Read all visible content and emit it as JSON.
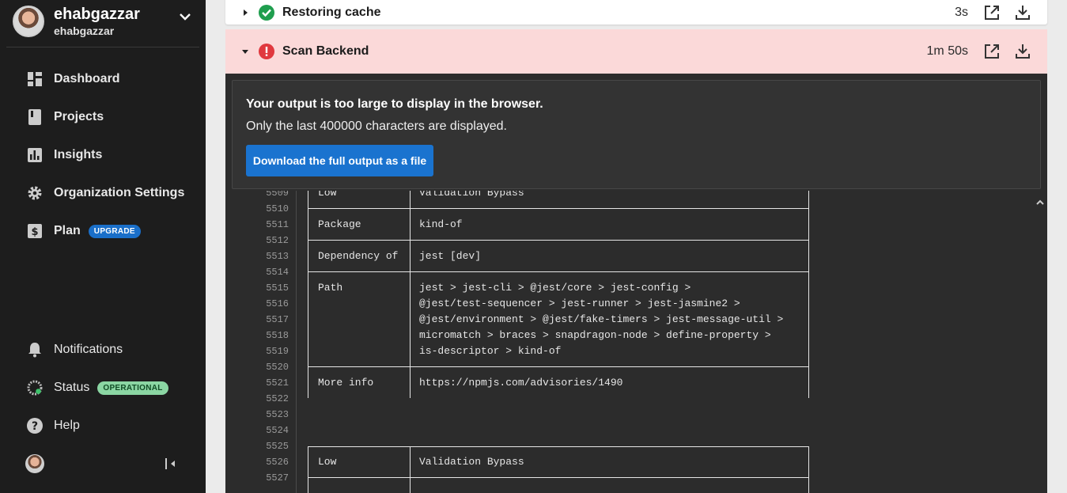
{
  "account": {
    "name": "ehabgazzar",
    "org": "ehabgazzar"
  },
  "nav": [
    {
      "label": "Dashboard",
      "icon": "dashboard-icon"
    },
    {
      "label": "Projects",
      "icon": "projects-icon"
    },
    {
      "label": "Insights",
      "icon": "insights-icon"
    },
    {
      "label": "Organization Settings",
      "icon": "gear-icon"
    },
    {
      "label": "Plan",
      "icon": "dollar-icon",
      "badge": "UPGRADE"
    }
  ],
  "nav_bottom": [
    {
      "label": "Notifications",
      "icon": "bell-icon"
    },
    {
      "label": "Status",
      "icon": "status-icon",
      "badge": "OPERATIONAL"
    },
    {
      "label": "Help",
      "icon": "help-icon"
    }
  ],
  "steps": {
    "restoring": {
      "title": "Restoring cache",
      "duration": "3s",
      "status": "success"
    },
    "scan": {
      "title": "Scan Backend",
      "duration": "1m 50s",
      "status": "failed"
    }
  },
  "output_notice": {
    "title": "Your output is too large to display in the browser.",
    "subtitle": "Only the last 400000 characters are displayed.",
    "download_label": "Download the full output as a file"
  },
  "log_lines": [
    {
      "n": "5509",
      "c1": "Low",
      "c2": "Validation Bypass"
    },
    {
      "n": "5510",
      "c1": "",
      "c2": ""
    },
    {
      "n": "5511",
      "c1": "Package",
      "c2": "kind-of"
    },
    {
      "n": "5512",
      "c1": "",
      "c2": ""
    },
    {
      "n": "5513",
      "c1": "Dependency of",
      "c2": "jest [dev]"
    },
    {
      "n": "5514",
      "c1": "",
      "c2": ""
    },
    {
      "n": "5515",
      "c1": "Path",
      "c2": "jest > jest-cli > @jest/core > jest-config >"
    },
    {
      "n": "5516",
      "c1": "",
      "c2": "@jest/test-sequencer > jest-runner > jest-jasmine2 >"
    },
    {
      "n": "5517",
      "c1": "",
      "c2": "@jest/environment > @jest/fake-timers > jest-message-util >"
    },
    {
      "n": "5518",
      "c1": "",
      "c2": "micromatch > braces > snapdragon-node > define-property >"
    },
    {
      "n": "5519",
      "c1": "",
      "c2": "is-descriptor > kind-of"
    },
    {
      "n": "5520",
      "c1": "",
      "c2": ""
    },
    {
      "n": "5521",
      "c1": "More info",
      "c2": "https://npmjs.com/advisories/1490"
    },
    {
      "n": "5522",
      "c1": "",
      "c2": ""
    },
    {
      "n": "5523",
      "c1": "",
      "c2": ""
    },
    {
      "n": "5524",
      "c1": "",
      "c2": ""
    },
    {
      "n": "5525",
      "c1": "",
      "c2": ""
    },
    {
      "n": "5526",
      "c1": "Low",
      "c2": "Validation Bypass"
    },
    {
      "n": "5527",
      "c1": "",
      "c2": ""
    }
  ]
}
